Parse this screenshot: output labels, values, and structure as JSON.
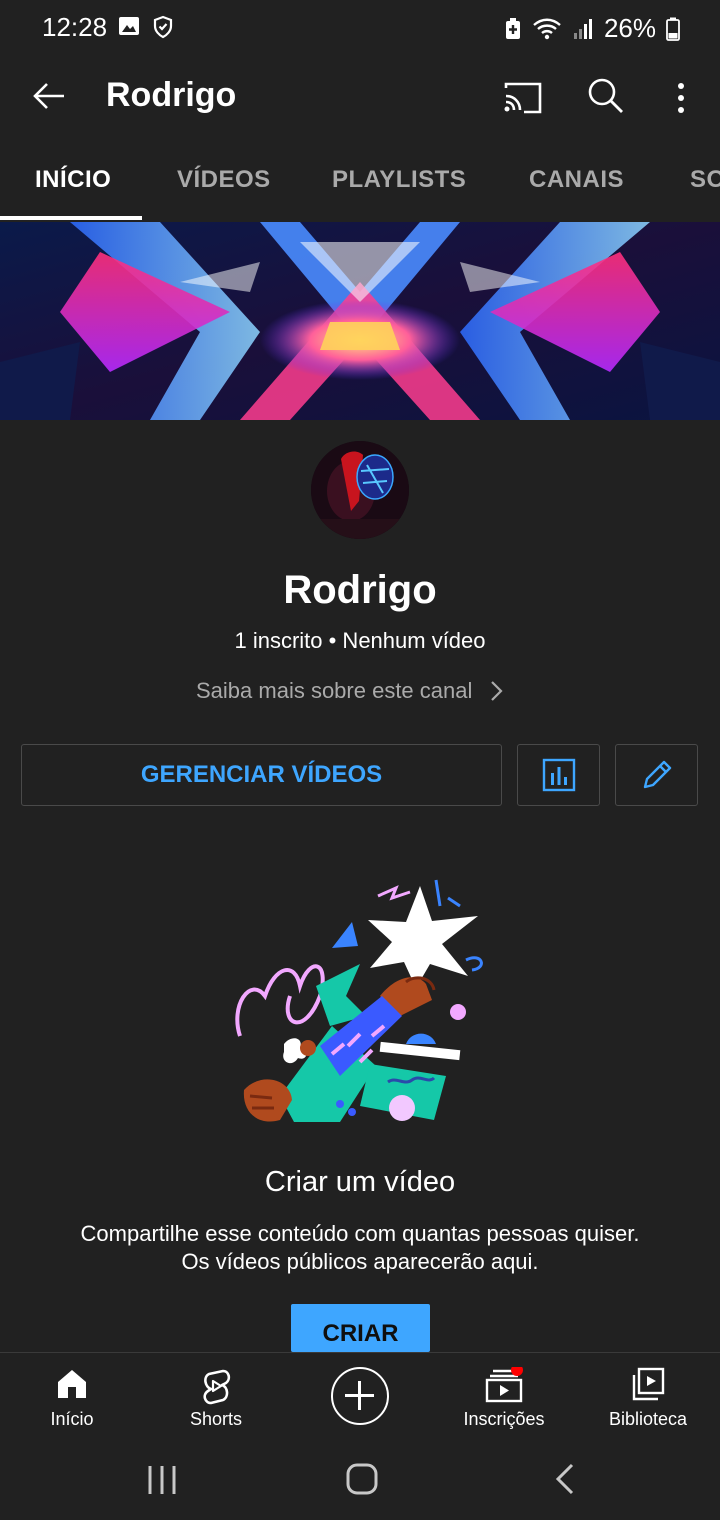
{
  "status_bar": {
    "time": "12:28",
    "battery": "26%"
  },
  "app_bar": {
    "title": "Rodrigo"
  },
  "tabs": [
    {
      "label": "INÍCIO",
      "active": true
    },
    {
      "label": "VÍDEOS",
      "active": false
    },
    {
      "label": "PLAYLISTS",
      "active": false
    },
    {
      "label": "CANAIS",
      "active": false
    },
    {
      "label": "SO",
      "active": false
    }
  ],
  "channel": {
    "name": "Rodrigo",
    "stats": "1 inscrito • Nenhum vídeo",
    "about_link": "Saiba mais sobre este canal"
  },
  "actions": {
    "manage_label": "GERENCIAR VÍDEOS"
  },
  "empty_state": {
    "title": "Criar um vídeo",
    "line1": "Compartilhe esse conteúdo com quantas pessoas quiser.",
    "line2": "Os vídeos públicos aparecerão aqui.",
    "button": "CRIAR"
  },
  "bottom_nav": [
    {
      "label": "Início",
      "icon": "home-icon"
    },
    {
      "label": "Shorts",
      "icon": "shorts-icon"
    },
    {
      "label": "",
      "icon": "create-icon"
    },
    {
      "label": "Inscrições",
      "icon": "subscriptions-icon"
    },
    {
      "label": "Biblioteca",
      "icon": "library-icon"
    }
  ],
  "colors": {
    "background": "#212121",
    "accent": "#3ea6ff",
    "notification": "#ff0000"
  }
}
